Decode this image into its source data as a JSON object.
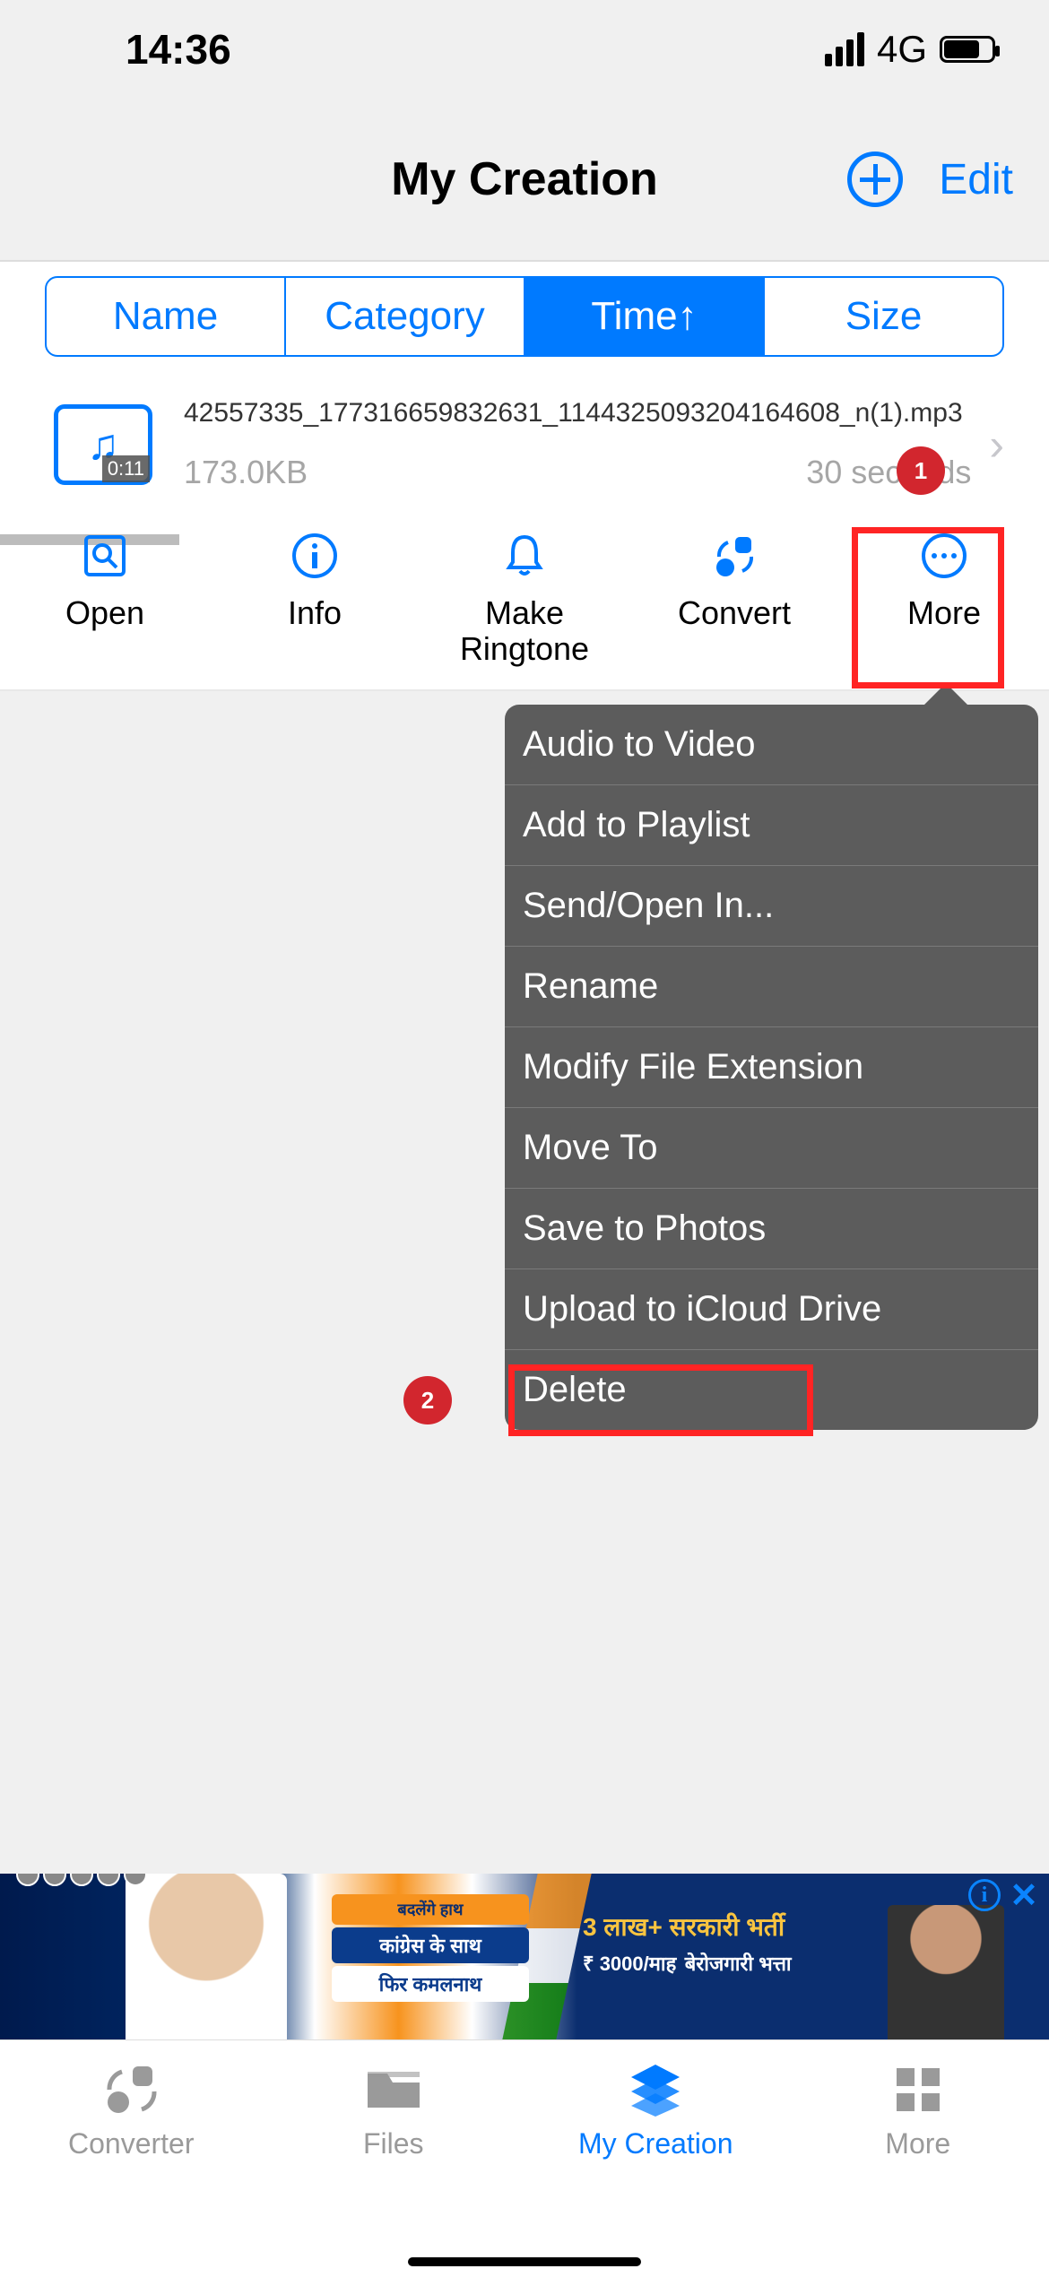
{
  "status": {
    "time": "14:36",
    "network": "4G"
  },
  "nav": {
    "title": "My Creation",
    "edit": "Edit"
  },
  "segments": {
    "name": "Name",
    "category": "Category",
    "time": "Time↑",
    "size": "Size"
  },
  "file": {
    "name": "42557335_177316659832631_1144325093204164608_n(1).mp3",
    "size": "173.0KB",
    "duration": "30 seconds",
    "position": "0:11"
  },
  "actions": {
    "open": "Open",
    "info": "Info",
    "ringtone": "Make Ringtone",
    "convert": "Convert",
    "more": "More"
  },
  "menu": {
    "audio_video": "Audio to Video",
    "playlist": "Add to Playlist",
    "send": "Send/Open In...",
    "rename": "Rename",
    "ext": "Modify File Extension",
    "move": "Move To",
    "save_photos": "Save to Photos",
    "icloud": "Upload to iCloud Drive",
    "delete": "Delete"
  },
  "badges": {
    "b1": "1",
    "b2": "2"
  },
  "ad": {
    "line1": "बदलेंगे हाथ",
    "line2": "कांग्रेस के साथ",
    "line3": "फिर कमलनाथ",
    "line4": "3 लाख+ सरकारी भर्ती",
    "line5": "₹ 3000/माह",
    "line6": "बेरोजगारी भत्ता",
    "info": "i"
  },
  "tabs": {
    "converter": "Converter",
    "files": "Files",
    "creation": "My Creation",
    "more": "More"
  }
}
